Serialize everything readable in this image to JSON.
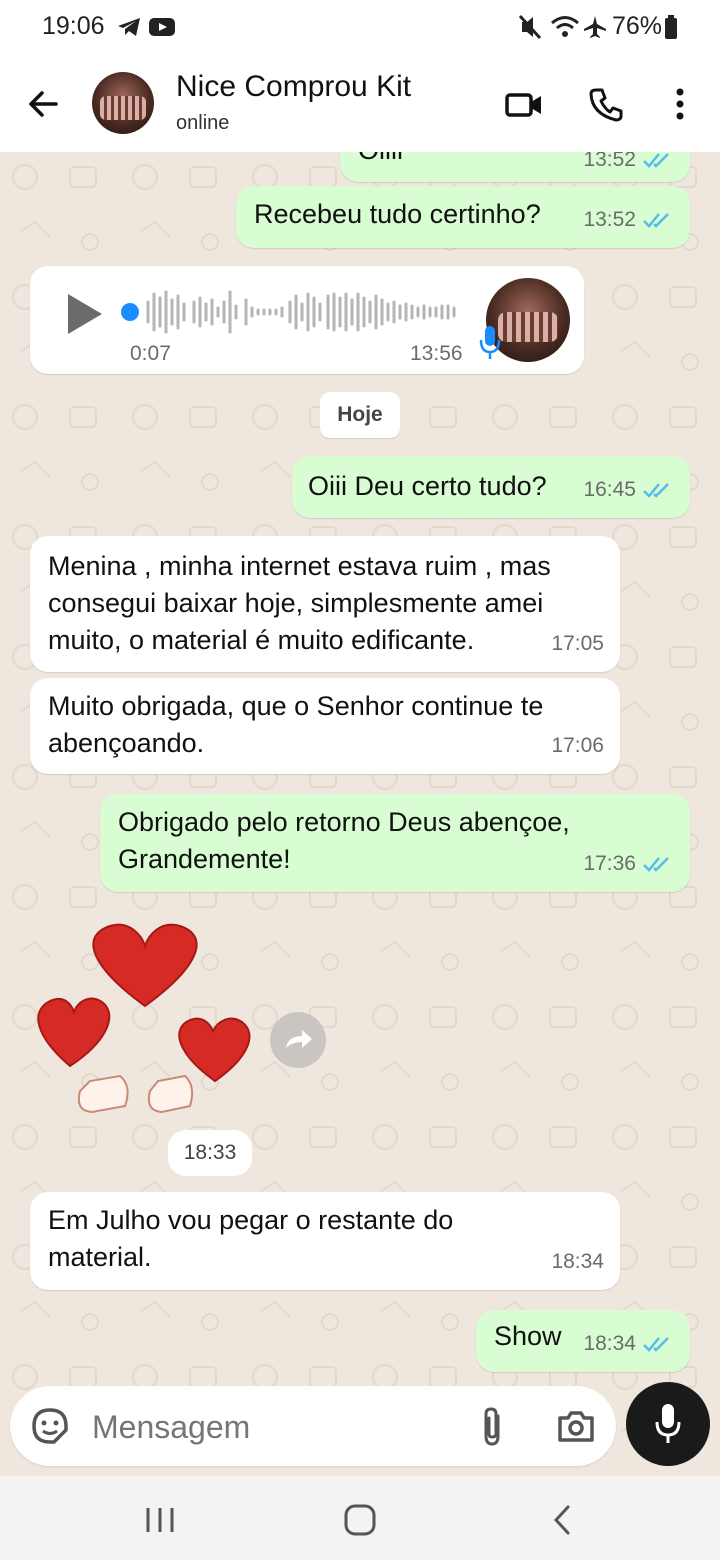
{
  "status_bar": {
    "time": "19:06",
    "battery": "76%",
    "icons": [
      "telegram-icon",
      "youtube-icon",
      "mute-icon",
      "wifi-icon",
      "airplane-icon",
      "battery-icon"
    ]
  },
  "header": {
    "title": "Nice Comprou Kit",
    "status": "online"
  },
  "messages": {
    "partial_top": {
      "text": "Oiiii",
      "time": "13:52"
    },
    "m1": {
      "text": "Recebeu tudo certinho?",
      "time": "13:52"
    },
    "voice": {
      "duration": "0:07",
      "time": "13:56"
    },
    "date_divider": "Hoje",
    "m2": {
      "text": "Oiii Deu certo tudo?",
      "time": "16:45"
    },
    "m3": {
      "line1": "Menina , minha internet estava ruim , mas",
      "line2": "consegui baixar hoje, simplesmente amei",
      "line3": "muito, o material é muito edificante.",
      "time": "17:05"
    },
    "m4": {
      "line1": "Muito obrigada, que o Senhor continue te",
      "line2": "abençoando.",
      "time": "17:06"
    },
    "m5": {
      "line1": "Obrigado pelo retorno Deus abençoe,",
      "line2": "Grandemente!",
      "time": "17:36"
    },
    "sticker": {
      "time": "18:33"
    },
    "m6": {
      "line1": "Em Julho vou pegar o restante do",
      "line2": "material.",
      "time": "18:34"
    },
    "m7": {
      "text": "Show",
      "time": "18:34"
    }
  },
  "composer": {
    "placeholder": "Mensagem"
  },
  "colors": {
    "outgoing": "#d9fdd3",
    "incoming": "#ffffff",
    "read_tick": "#53bdeb",
    "background": "#efe7dd"
  }
}
